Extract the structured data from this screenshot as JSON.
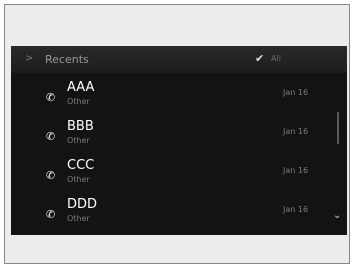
{
  "header": {
    "back_icon": "chevron-right-icon",
    "back_symbol": ">",
    "title": "Recents",
    "check_symbol": "✔",
    "filter_label": "All"
  },
  "recents": [
    {
      "name": "AAA",
      "type": "Other",
      "date": "Jan 16"
    },
    {
      "name": "BBB",
      "type": "Other",
      "date": "Jan 16"
    },
    {
      "name": "CCC",
      "type": "Other",
      "date": "Jan 16"
    },
    {
      "name": "DDD",
      "type": "Other",
      "date": "Jan 16"
    }
  ],
  "icons": {
    "call": "phone-call-icon",
    "call_symbol": "✆",
    "scroll_down": "chevron-down-icon",
    "scroll_down_symbol": "⌄"
  },
  "colors": {
    "screen_bg": "#131313",
    "header_bg": "#222222",
    "text_primary": "#ffffff",
    "text_secondary": "#7a7a7a"
  }
}
